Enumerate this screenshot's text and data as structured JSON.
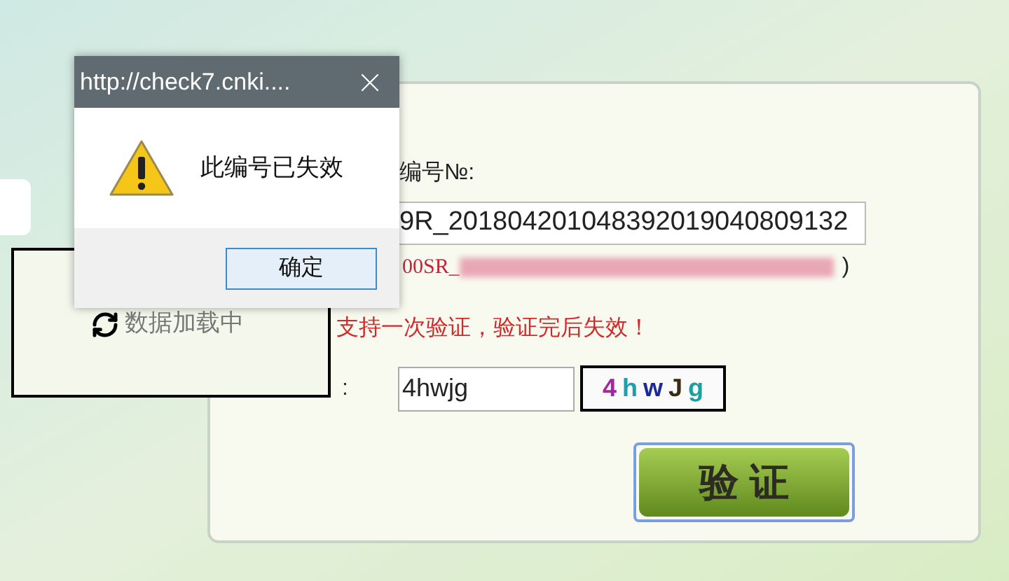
{
  "dialog": {
    "title": "http://check7.cnki....",
    "message": "此编号已失效",
    "ok_button": "确定"
  },
  "loading": {
    "text": "数据加载中"
  },
  "form": {
    "number_label": "编号№:",
    "number_value": "9R_201804201048392019040809132",
    "example_prefix": "00SR_",
    "example_close": ")",
    "warning": "支持一次验证，验证完后失效！",
    "captcha_label": ":",
    "captcha_value": "4hwjg",
    "captcha_image": "4hwJg",
    "submit_button": "验 证"
  }
}
